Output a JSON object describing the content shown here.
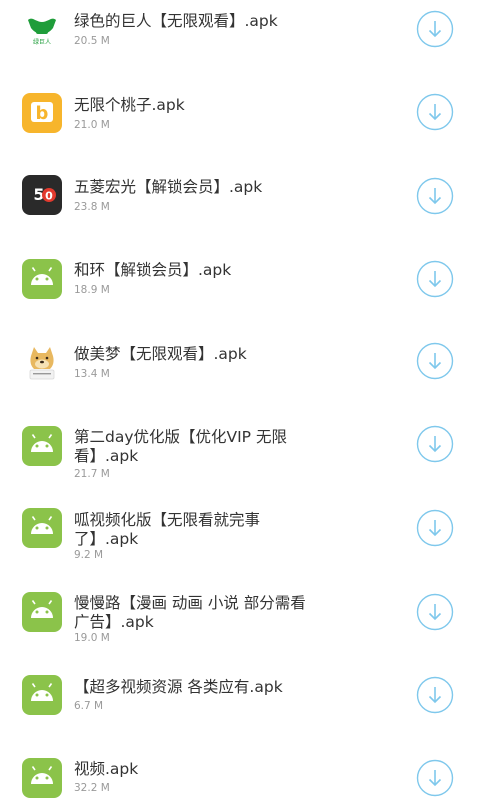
{
  "apps": [
    {
      "name": "绿色的巨人【无限观看】.apk",
      "size": "20.5 M",
      "icon": "green-giant-icon",
      "color": "#1f9d3a",
      "icon_text": "绿巨人"
    },
    {
      "name": "无限个桃子.apk",
      "size": "21.0 M",
      "icon": "peach-b-icon",
      "color": "#f7b52c",
      "icon_text": "b"
    },
    {
      "name": "五菱宏光【解锁会员】.apk",
      "size": "23.8 M",
      "icon": "wuling-50-icon",
      "color": "#2a2a2a",
      "icon_text": "50"
    },
    {
      "name": "和环【解锁会员】.apk",
      "size": "18.9 M",
      "icon": "android-icon",
      "color": "#8bc34a"
    },
    {
      "name": "做美梦【无限观看】.apk",
      "size": "13.4 M",
      "icon": "doge-icon",
      "color": "#e8b860"
    },
    {
      "name": "第二day优化版【优化VIP 无限\n看】.apk",
      "size": "21.7 M",
      "icon": "android-icon",
      "color": "#8bc34a"
    },
    {
      "name": "呱视频化版【无限看就完事\n了】.apk",
      "size": "9.2 M",
      "icon": "android-icon",
      "color": "#8bc34a"
    },
    {
      "name": "慢慢路【漫画 动画 小说 部分需看\n广告】.apk",
      "size": "19.0 M",
      "icon": "android-icon",
      "color": "#8bc34a"
    },
    {
      "name": "【超多视频资源 各类应有.apk",
      "size": "6.7 M",
      "icon": "android-icon",
      "color": "#8bc34a"
    },
    {
      "name": "视频.apk",
      "size": "32.2 M",
      "icon": "android-icon",
      "color": "#8bc34a"
    }
  ],
  "download_button": {
    "icon": "download-arrow-icon",
    "color": "#7fc8ec"
  }
}
